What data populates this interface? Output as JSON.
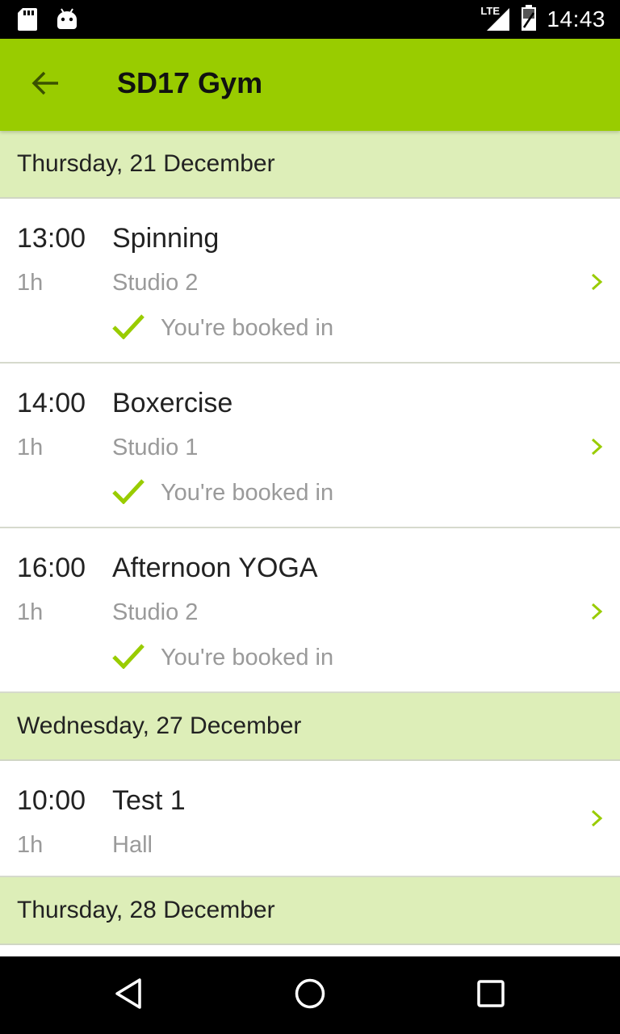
{
  "status_bar": {
    "time": "14:43",
    "network": "LTE",
    "icons": [
      "sd-card-icon",
      "android-icon",
      "signal-icon",
      "battery-icon"
    ]
  },
  "app_bar": {
    "title": "SD17 Gym",
    "back_icon": "arrow-back-icon"
  },
  "colors": {
    "accent": "#99cc00",
    "day_header_bg": "#ddeeb8",
    "secondary_text": "#9a9a9a"
  },
  "days": [
    {
      "label": "Thursday, 21 December",
      "sessions": [
        {
          "time": "13:00",
          "name": "Spinning",
          "duration": "1h",
          "location": "Studio 2",
          "status": "You're booked in"
        },
        {
          "time": "14:00",
          "name": "Boxercise",
          "duration": "1h",
          "location": "Studio 1",
          "status": "You're booked in"
        },
        {
          "time": "16:00",
          "name": "Afternoon YOGA",
          "duration": "1h",
          "location": "Studio 2",
          "status": "You're booked in"
        }
      ]
    },
    {
      "label": "Wednesday, 27 December",
      "sessions": [
        {
          "time": "10:00",
          "name": "Test 1",
          "duration": "1h",
          "location": "Hall"
        }
      ]
    },
    {
      "label": "Thursday, 28 December",
      "sessions": []
    }
  ],
  "nav_bar": {
    "icons": [
      "back-triangle-icon",
      "home-circle-icon",
      "recents-square-icon"
    ]
  }
}
